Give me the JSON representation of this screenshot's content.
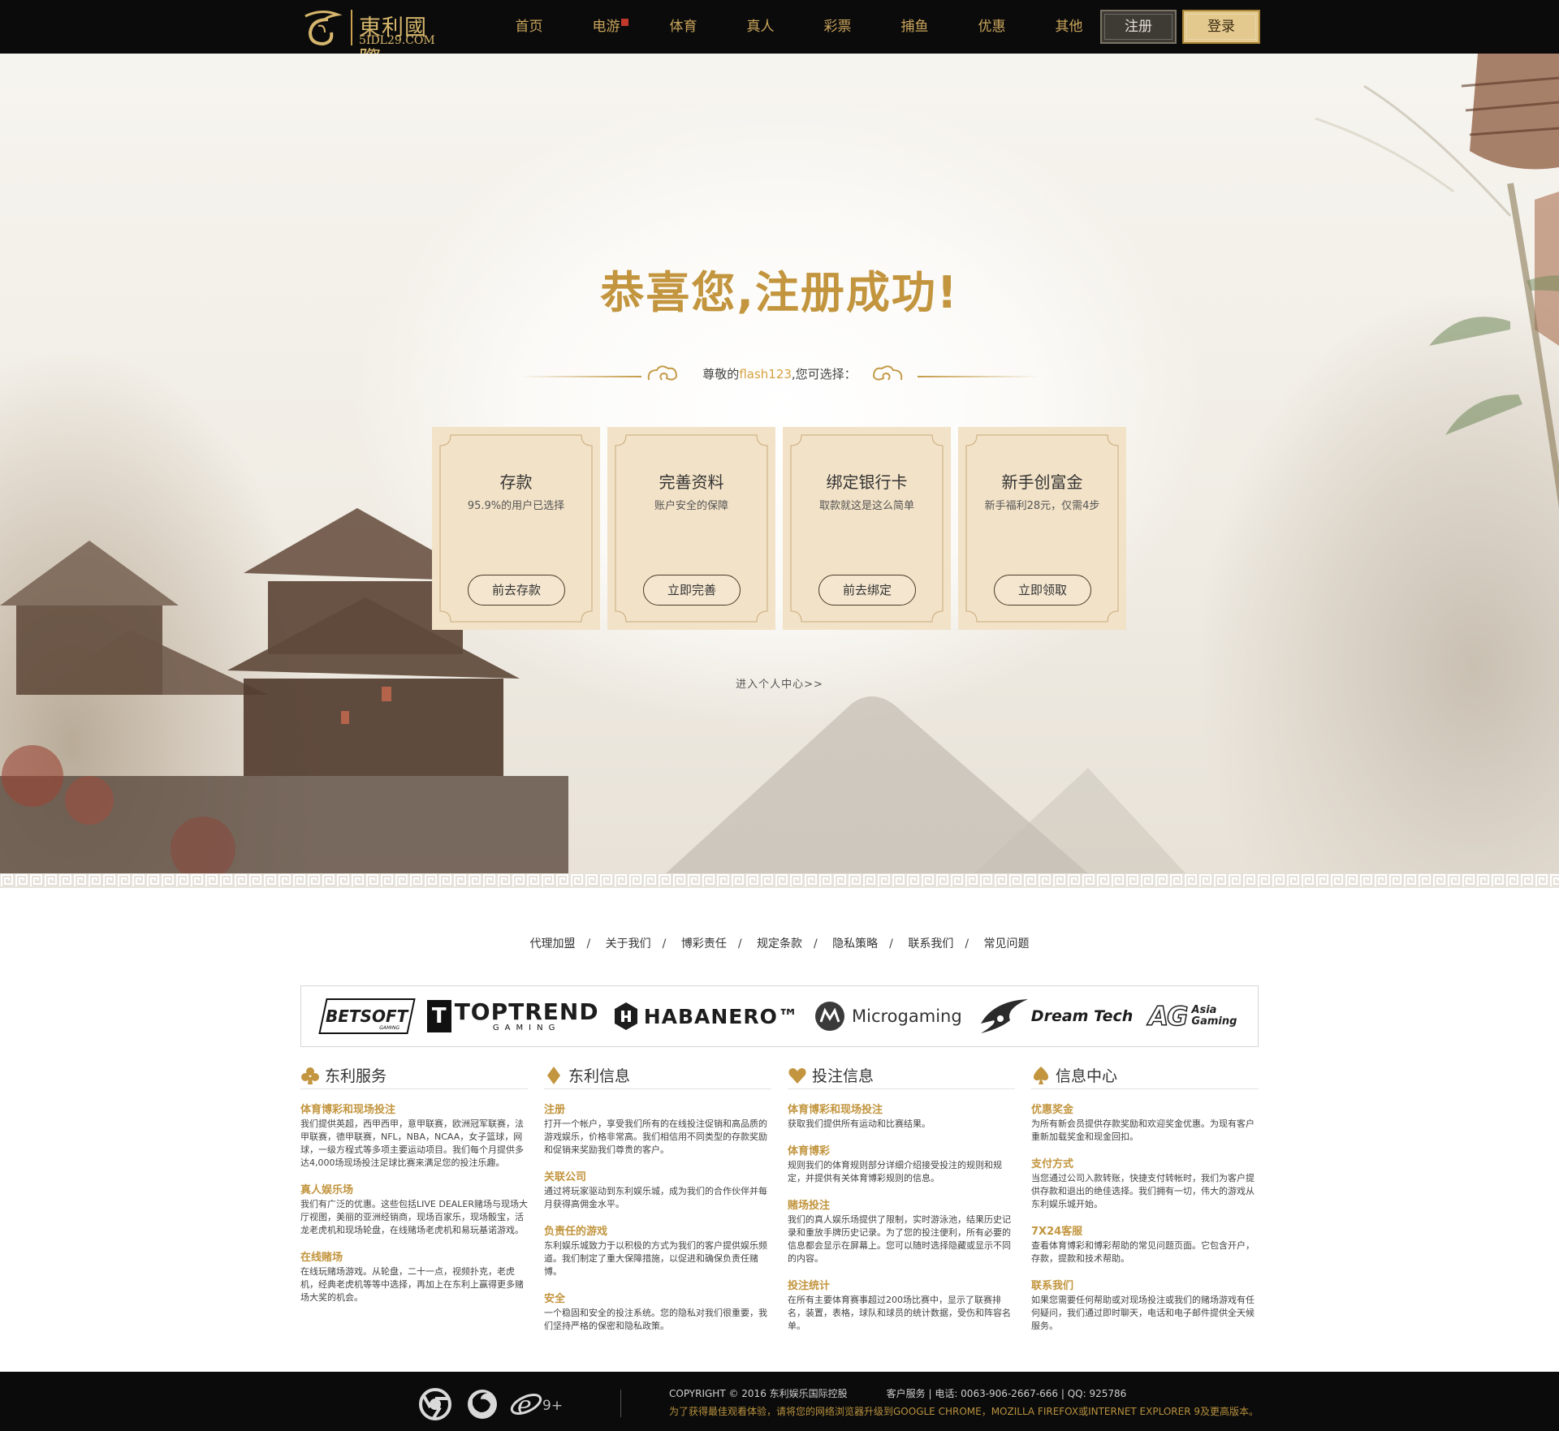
{
  "header": {
    "logo_cn": "東利國際",
    "logo_en": "5IDL29.COM",
    "nav": [
      {
        "label": "首页"
      },
      {
        "label": "电游",
        "hot": true
      },
      {
        "label": "体育"
      },
      {
        "label": "真人"
      },
      {
        "label": "彩票"
      },
      {
        "label": "捕鱼"
      },
      {
        "label": "优惠"
      },
      {
        "label": "其他"
      }
    ],
    "register": "注册",
    "login": "登录"
  },
  "hero": {
    "title": "恭喜您,注册成功!",
    "greeting_prefix": "尊敬的",
    "username": "flash123",
    "greeting_suffix": ",您可选择：",
    "cards": [
      {
        "title": "存款",
        "subtitle": "95.9%的用户已选择",
        "button": "前去存款"
      },
      {
        "title": "完善资料",
        "subtitle": "账户安全的保障",
        "button": "立即完善"
      },
      {
        "title": "绑定银行卡",
        "subtitle": "取款就这是这么简单",
        "button": "前去绑定"
      },
      {
        "title": "新手创富金",
        "subtitle": "新手福利28元，仅需4步",
        "button": "立即领取"
      }
    ],
    "personal_center": "进入个人中心>>"
  },
  "footer_links": [
    "代理加盟",
    "关于我们",
    "博彩责任",
    "规定条款",
    "隐私策略",
    "联系我们",
    "常见问题"
  ],
  "partners": {
    "betsoft": "BETSOFT",
    "betsoft_sub": "GAMING",
    "toptrend": "TOPTREND",
    "toptrend_sub": "GAMING",
    "habanero": "HABANERO™",
    "microgaming": "Microgaming",
    "dreamtech": "Dream Tech",
    "ag": "AG",
    "ag_sub1": "Asia",
    "ag_sub2": "Gaming"
  },
  "info_columns": [
    {
      "title": "东利服务",
      "icon": "club-icon",
      "items": [
        {
          "title": "体育博彩和现场投注",
          "body": "我们提供英超，西甲西甲，意甲联赛，欧洲冠军联赛，法甲联赛，德甲联赛，NFL，NBA，NCAA，女子篮球，网球，一级方程式等多项主要运动项目。我们每个月提供多达4,000场现场投注足球比赛来满足您的投注乐趣。"
        },
        {
          "title": "真人娱乐场",
          "body": "我们有广泛的优惠。这些包括LIVE DEALER赌场与现场大厅视图，美丽的亚洲经销商，现场百家乐，现场骰宝，活龙老虎机和现场轮盘，在线赌场老虎机和易玩基诺游戏。"
        },
        {
          "title": "在线赌场",
          "body": "在线玩赌场游戏。从轮盘，二十一点，视频扑克，老虎机，经典老虎机等等中选择，再加上在东利上赢得更多赌场大奖的机会。"
        }
      ]
    },
    {
      "title": "东利信息",
      "icon": "diamond-icon",
      "items": [
        {
          "title": "注册",
          "body": "打开一个帐户，享受我们所有的在线投注促销和高品质的游戏娱乐，价格非常高。我们相信用不同类型的存款奖励和促销来奖励我们尊贵的客户。"
        },
        {
          "title": "关联公司",
          "body": "通过将玩家驱动到东利娱乐城，成为我们的合作伙伴并每月获得高佣金水平。"
        },
        {
          "title": "负责任的游戏",
          "body": "东利娱乐城致力于以积极的方式为我们的客户提供娱乐频道。我们制定了重大保障措施，以促进和确保负责任赌博。"
        },
        {
          "title": "安全",
          "body": "一个稳固和安全的投注系统。您的隐私对我们很重要，我们坚持严格的保密和隐私政策。"
        }
      ]
    },
    {
      "title": "投注信息",
      "icon": "heart-icon",
      "items": [
        {
          "title": "体育博彩和现场投注",
          "body": "获取我们提供所有运动和比赛结果。"
        },
        {
          "title": "体育博彩",
          "body": "规则我们的体育规则部分详细介绍接受投注的规则和规定，并提供有关体育博彩规则的信息。"
        },
        {
          "title": "赌场投注",
          "body": "我们的真人娱乐场提供了限制，实时游泳池，结果历史记录和重放手牌历史记录。为了您的投注便利，所有必要的信息都会显示在屏幕上。您可以随时选择隐藏或显示不同的内容。"
        },
        {
          "title": "投注统计",
          "body": "在所有主要体育赛事超过200场比赛中，显示了联赛排名，装置，表格，球队和球员的统计数据，受伤和阵容名单。"
        }
      ]
    },
    {
      "title": "信息中心",
      "icon": "spade-icon",
      "items": [
        {
          "title": "优惠奖金",
          "body": "为所有新会员提供存款奖励和欢迎奖金优惠。为现有客户重新加载奖金和现金回扣。"
        },
        {
          "title": "支付方式",
          "body": "当您通过公司入款转账，快捷支付转帐时，我们为客户提供存款和退出的绝佳选择。我们拥有一切，伟大的游戏从东利娱乐城开始。"
        },
        {
          "title": "7X24客服",
          "body": "查看体育博彩和博彩帮助的常见问题页面。它包含开户，存款，提款和技术帮助。"
        },
        {
          "title": "联系我们",
          "body": "如果您需要任何帮助或对现场投注或我们的赌场游戏有任何疑问，我们通过即时聊天，电话和电子邮件提供全天候服务。"
        }
      ]
    }
  ],
  "bottom": {
    "ie_version": "9+",
    "copyright": "COPYRIGHT © 2016 东利娱乐国际控股",
    "service": "客户服务 | 电话: 0063-906-2667-666 | QQ: 925786",
    "upgrade_notice": "为了获得最佳观看体验，请将您的网络浏览器升级到GOOGLE CHROME，MOZILLA FIREFOX或INTERNET EXPLORER 9及更高版本。"
  },
  "colors": {
    "gold": "#c2953e",
    "card_bg": "#f2e2c7",
    "bar_bg": "#0b0b0b",
    "nav_text": "#c9a45b"
  }
}
